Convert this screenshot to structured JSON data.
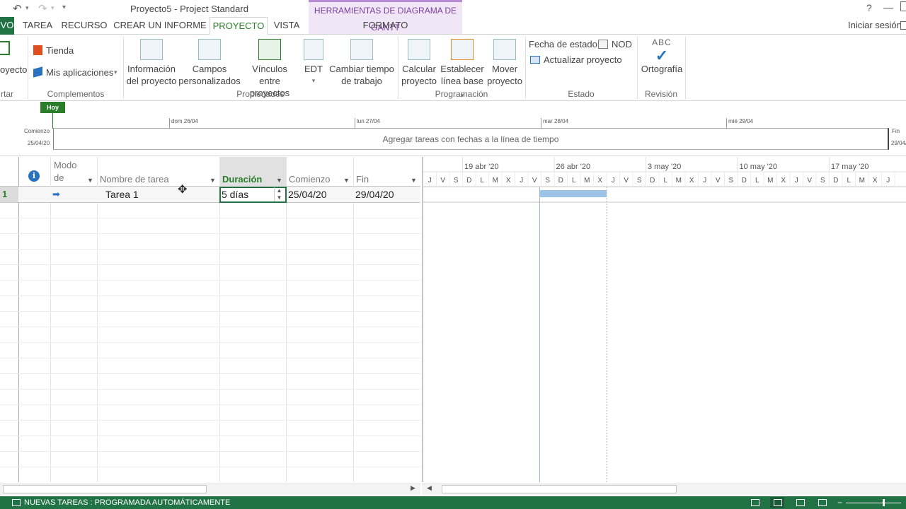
{
  "title_bar": {
    "title": "Proyecto5 - Project Standard",
    "help": "?",
    "qat_undo": "↶",
    "qat_redo": "↷",
    "qat_more": "▾"
  },
  "context_tab_group": "HERRAMIENTAS DE DIAGRAMA DE GANTT",
  "tabs": [
    {
      "label": "VO"
    },
    {
      "label": "TAREA"
    },
    {
      "label": "RECURSO"
    },
    {
      "label": "CREAR UN INFORME"
    },
    {
      "label": "PROYECTO"
    },
    {
      "label": "VISTA"
    },
    {
      "label": "FORMATO"
    }
  ],
  "signin": "Iniciar sesión",
  "ribbon": {
    "insert_partial": "oyecto",
    "insert_group_partial": "rtar",
    "complementos": {
      "tienda": "Tienda",
      "mis_apps": "Mis aplicaciones",
      "group": "Complementos"
    },
    "propiedades": {
      "info_1": "Información",
      "info_2": "del proyecto",
      "campos_1": "Campos",
      "campos_2": "personalizados",
      "vinculos_1": "Vínculos entre",
      "vinculos_2": "proyectos",
      "edt": "EDT",
      "cambiar_1": "Cambiar tiempo",
      "cambiar_2": "de trabajo",
      "group": "Propiedades"
    },
    "programacion": {
      "calc_1": "Calcular",
      "calc_2": "proyecto",
      "base_1": "Establecer",
      "base_2": "línea base",
      "mover_1": "Mover",
      "mover_2": "proyecto",
      "group": "Programación"
    },
    "estado": {
      "fecha": "Fecha de estado:",
      "fecha_val": "NOD",
      "actualizar": "Actualizar proyecto",
      "group": "Estado"
    },
    "revision": {
      "abc": "ABC",
      "orto": "Ortografía",
      "group": "Revisión"
    }
  },
  "timeline": {
    "today": "Hoy",
    "start_label": "Comienzo",
    "start_date": "25/04/20",
    "end_label": "Fin",
    "end_date": "29/04/",
    "placeholder": "Agregar tareas con fechas a la línea de tiempo",
    "ticks": [
      "dom 26/04",
      "lun 27/04",
      "mar 28/04",
      "mié 29/04"
    ]
  },
  "grid": {
    "col_modo_1": "Modo",
    "col_modo_2": "de",
    "col_name": "Nombre de tarea",
    "col_dur": "Duración",
    "col_start": "Comienzo",
    "col_end": "Fin",
    "rows": [
      {
        "id": "1",
        "name": "Tarea 1",
        "duration": "5 días",
        "start": "25/04/20",
        "end": "29/04/20"
      }
    ]
  },
  "gantt": {
    "weeks": [
      "19 abr '20",
      "26 abr '20",
      "3 may '20",
      "10 may '20",
      "17 may '20"
    ],
    "days": [
      "J",
      "V",
      "S",
      "D",
      "L",
      "M",
      "X",
      "J",
      "V",
      "S",
      "D",
      "L",
      "M",
      "X",
      "J",
      "V",
      "S",
      "D",
      "L",
      "M",
      "X",
      "J",
      "V",
      "S",
      "D",
      "L",
      "M",
      "X",
      "J",
      "V",
      "S",
      "D",
      "L",
      "M",
      "X",
      "J"
    ],
    "bar_color": "#9cc3e5"
  },
  "status": {
    "text": "NUEVAS TAREAS : PROGRAMADA AUTOMÁTICAMENTE"
  }
}
